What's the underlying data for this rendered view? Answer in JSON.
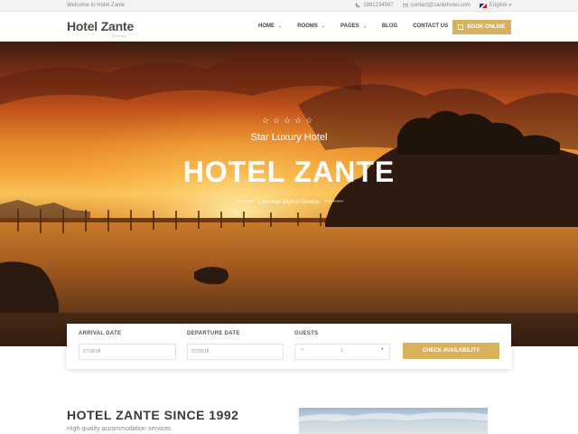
{
  "topbar": {
    "welcome": "Welcome to Hotel Zante",
    "phone": "1881234567",
    "email": "contact@zantehotel.com",
    "language": "English"
  },
  "nav": {
    "logo": "Hotel Zante",
    "logo_stars": "★★★★★",
    "items": [
      {
        "label": "HOME",
        "dropdown": "⌄"
      },
      {
        "label": "ROOMS",
        "dropdown": "⌄"
      },
      {
        "label": "PAGES",
        "dropdown": "⌄"
      },
      {
        "label": "BLOG",
        "dropdown": ""
      },
      {
        "label": "CONTACT US",
        "dropdown": ""
      }
    ],
    "book_label": "BOOK ONLINE"
  },
  "hero": {
    "stars": "☆☆☆☆☆",
    "subtitle": "Star Luxury Hotel",
    "title": "HOTEL ZANTE",
    "tagline": "Live Your Myth in Greece"
  },
  "booking": {
    "arrival_label": "ARRIVAL DATE",
    "arrival_value": "07/18/18",
    "departure_label": "DEPARTURE DATE",
    "departure_value": "07/20/18",
    "guests_label": "GUESTS",
    "guests_value": "1",
    "minus": "−",
    "plus": "+",
    "check_label": "CHECK AVAILABILITY"
  },
  "about": {
    "title": "HOTEL ZANTE SINCE 1992",
    "subtitle": "High quality accommodation services"
  },
  "colors": {
    "accent": "#d9b05c",
    "text_dark": "#3a3a3a"
  }
}
